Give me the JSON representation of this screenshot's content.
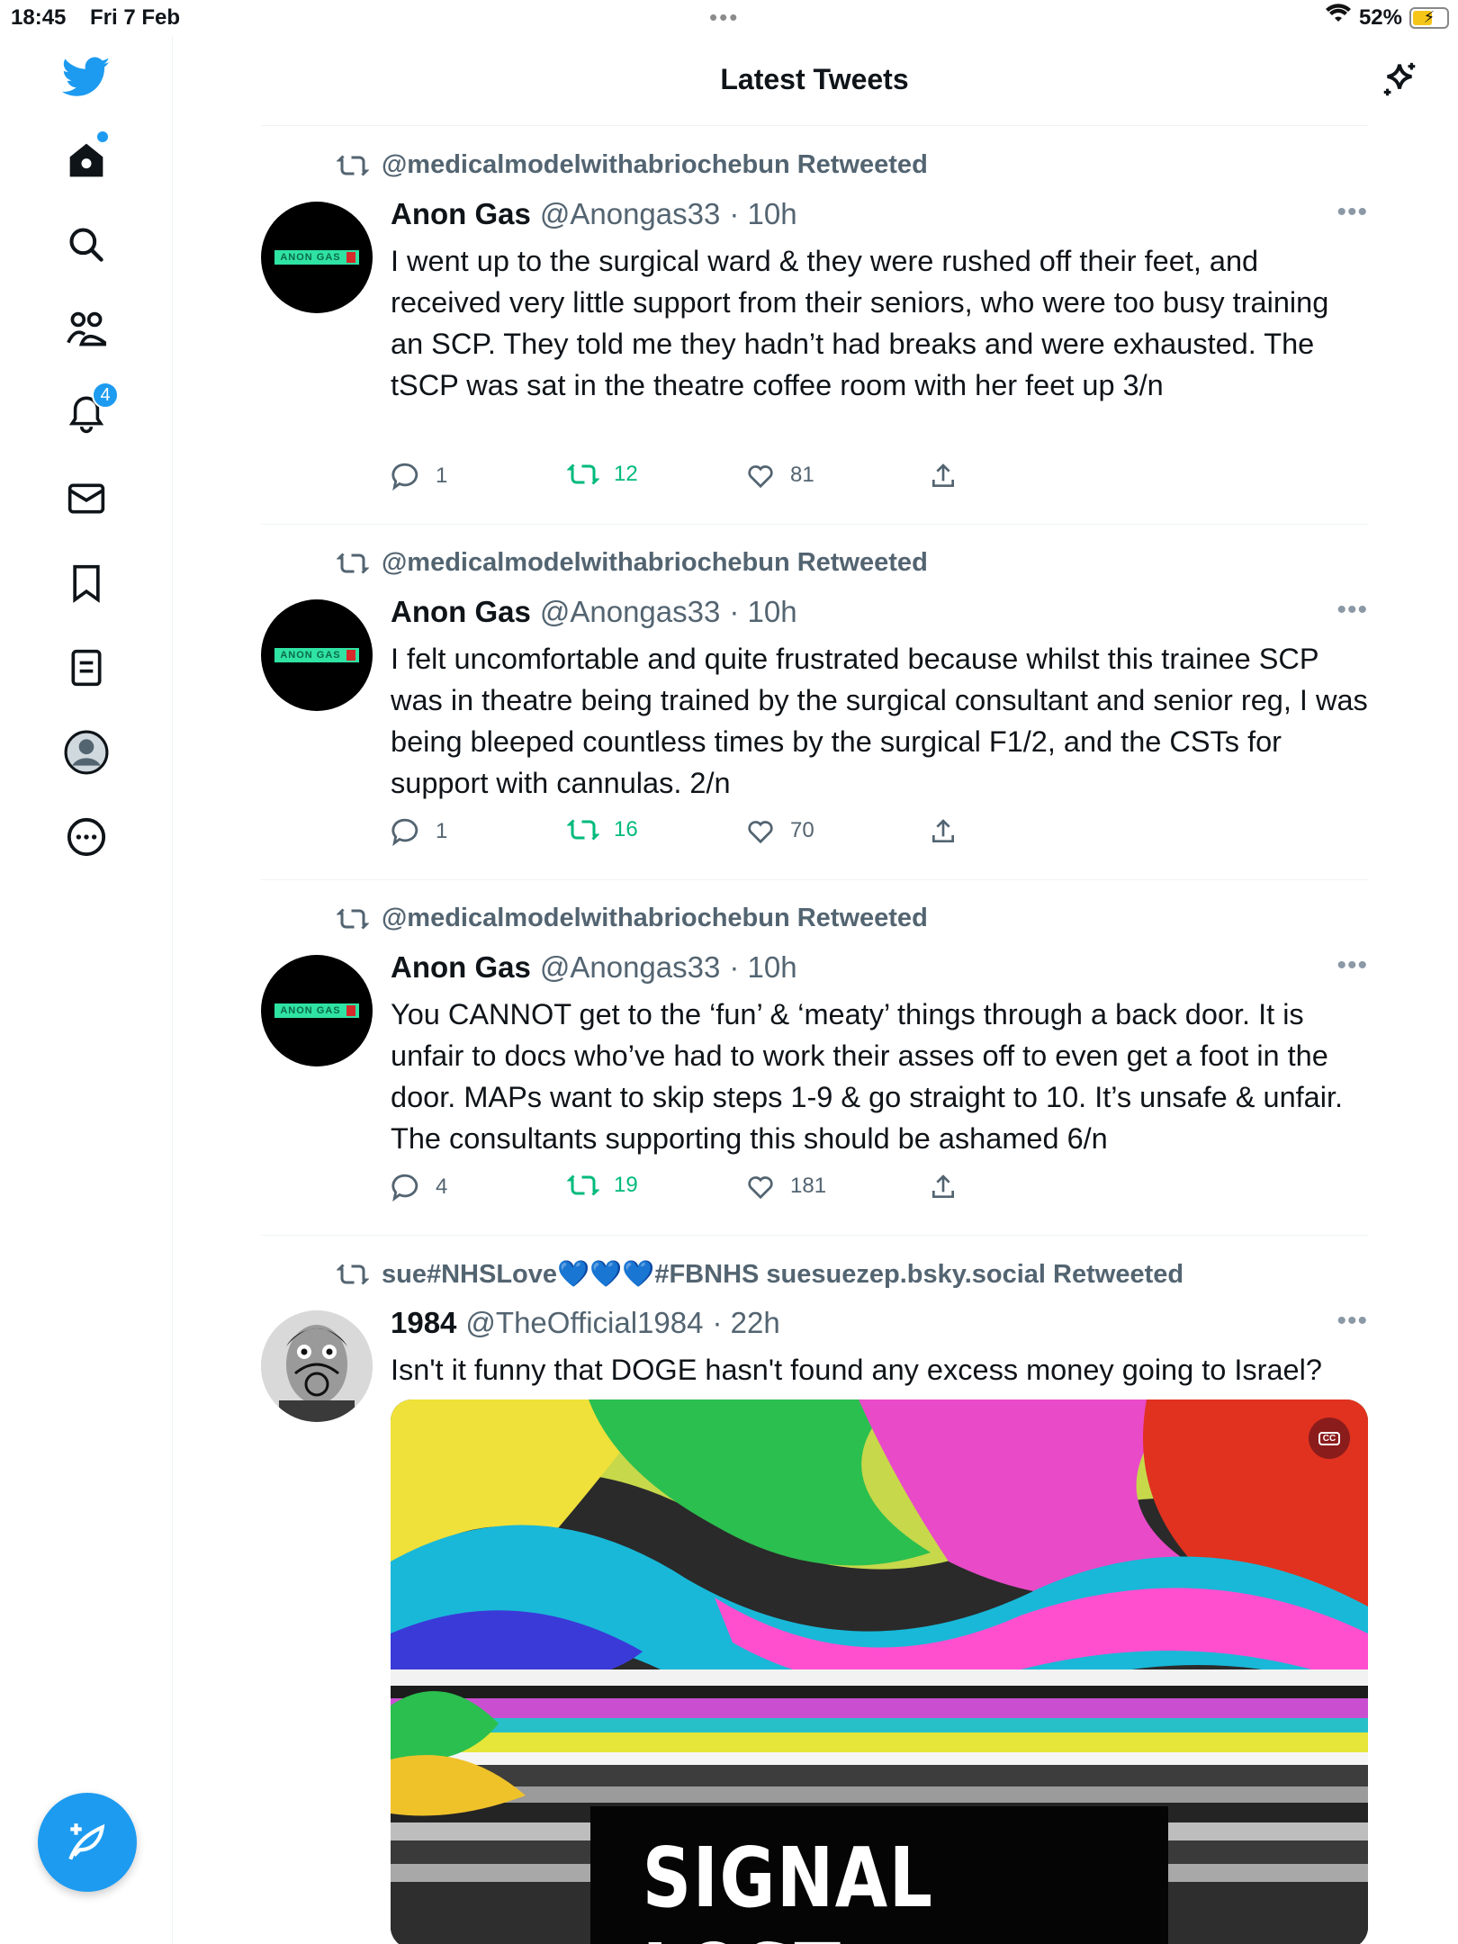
{
  "status_bar": {
    "time": "18:45",
    "date": "Fri 7 Feb",
    "battery": "52%"
  },
  "header": {
    "title": "Latest Tweets"
  },
  "sidebar": {
    "notifications_count": "4"
  },
  "tweets": [
    {
      "retweeted_by": "@medicalmodelwithabriochebun Retweeted",
      "name": "Anon Gas",
      "handle": "@Anongas33",
      "time": "· 10h",
      "avatar_label": "ANON GAS",
      "text": "I went up to the surgical ward & they were rushed off their feet, and received very little support from their seniors, who were too busy training an SCP. They told me they hadn’t had breaks and were exhausted. The tSCP was sat in the theatre coffee room with her feet up 3/n",
      "replies": "1",
      "retweets": "12",
      "likes": "81"
    },
    {
      "retweeted_by": "@medicalmodelwithabriochebun Retweeted",
      "name": "Anon Gas",
      "handle": "@Anongas33",
      "time": "· 10h",
      "avatar_label": "ANON GAS",
      "text": "I felt uncomfortable and quite frustrated because whilst this trainee SCP was in theatre being trained by the surgical consultant and senior reg, I was being bleeped countless times by the surgical F1/2, and the CSTs for support with cannulas. 2/n",
      "replies": "1",
      "retweets": "16",
      "likes": "70"
    },
    {
      "retweeted_by": "@medicalmodelwithabriochebun Retweeted",
      "name": "Anon Gas",
      "handle": "@Anongas33",
      "time": "· 10h",
      "avatar_label": "ANON GAS",
      "text": "You CANNOT get to the ‘fun’ & ‘meaty’ things through a back door. It is unfair to docs who’ve had to work their asses off to even get a foot in the door. MAPs want to skip steps 1-9 & go straight to 10. It’s unsafe & unfair. The consultants supporting this should be ashamed 6/n",
      "replies": "4",
      "retweets": "19",
      "likes": "181"
    },
    {
      "retweeted_by": "sue#NHSLove💙💙💙#FBNHS suesuezep.bsky.social Retweeted",
      "name": "1984",
      "handle": "@TheOfficial1984",
      "time": "· 22h",
      "text": "Isn't it funny that DOGE hasn't found any excess money going to Israel?",
      "media_text": "SIGNAL LOST"
    }
  ]
}
